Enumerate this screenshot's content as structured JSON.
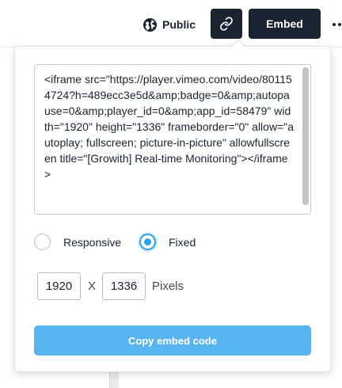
{
  "header": {
    "public_label": "Public",
    "embed_label": "Embed",
    "icons": {
      "visibility": "globe-icon",
      "link": "link-icon",
      "more": "more-dots-icon"
    }
  },
  "embed_panel": {
    "code": "<iframe src=\"https://player.vimeo.com/video/801154724?h=489ecc3e5d&amp;badge=0&amp;autopause=0&amp;player_id=0&amp;app_id=58479\" width=\"1920\" height=\"1336\" frameborder=\"0\" allow=\"autoplay; fullscreen; picture-in-picture\" allowfullscreen title=\"[Growith] Real-time Monitoring\"></iframe>",
    "size_mode": {
      "options": [
        "Responsive",
        "Fixed"
      ],
      "selected": "Fixed"
    },
    "width_value": "1920",
    "height_value": "1336",
    "separator": "X",
    "unit": "Pixels",
    "copy_label": "Copy embed code"
  },
  "colors": {
    "dark_button": "#1a2330",
    "accent": "#2ea0e8",
    "copy_button": "#58b4ef"
  }
}
